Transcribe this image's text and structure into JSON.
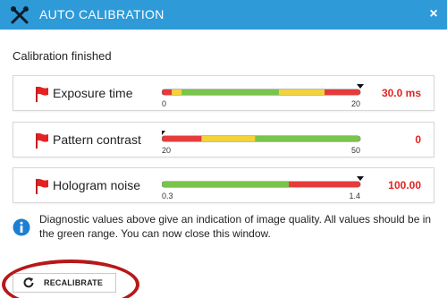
{
  "dialog": {
    "title": "AUTO CALIBRATION",
    "close_label": "×",
    "status": "Calibration finished",
    "accent_color": "#2e9ad8",
    "value_color": "#e52222",
    "rows": [
      {
        "label": "Exposure time",
        "value": "30.0 ms",
        "min_label": "0",
        "max_label": "20",
        "level": 1.0,
        "segments": [
          {
            "color": "#e53b3b",
            "frac": 0.05
          },
          {
            "color": "#f2d33a",
            "frac": 0.05
          },
          {
            "color": "#79c44a",
            "frac": 0.49
          },
          {
            "color": "#f2d33a",
            "frac": 0.23
          },
          {
            "color": "#e53b3b",
            "frac": 0.18
          }
        ]
      },
      {
        "label": "Pattern contrast",
        "value": "0",
        "min_label": "20",
        "max_label": "50",
        "level": 0.0,
        "segments": [
          {
            "color": "#e53b3b",
            "frac": 0.2
          },
          {
            "color": "#f2d33a",
            "frac": 0.27
          },
          {
            "color": "#79c44a",
            "frac": 0.53
          }
        ]
      },
      {
        "label": "Hologram noise",
        "value": "100.00",
        "min_label": "0.3",
        "max_label": "1.4",
        "level": 1.0,
        "segments": [
          {
            "color": "#79c44a",
            "frac": 0.64
          },
          {
            "color": "#e53b3b",
            "frac": 0.36
          }
        ]
      }
    ],
    "info": "Diagnostic values above give an indication of image quality. All values should be in the green range. You can now close this window.",
    "recalibrate_label": "RECALIBRATE",
    "highlight_color": "#b71818",
    "icons": {
      "title": "tools-icon",
      "flag": "flag-icon",
      "info": "info-icon",
      "recalibrate": "refresh-icon"
    }
  }
}
